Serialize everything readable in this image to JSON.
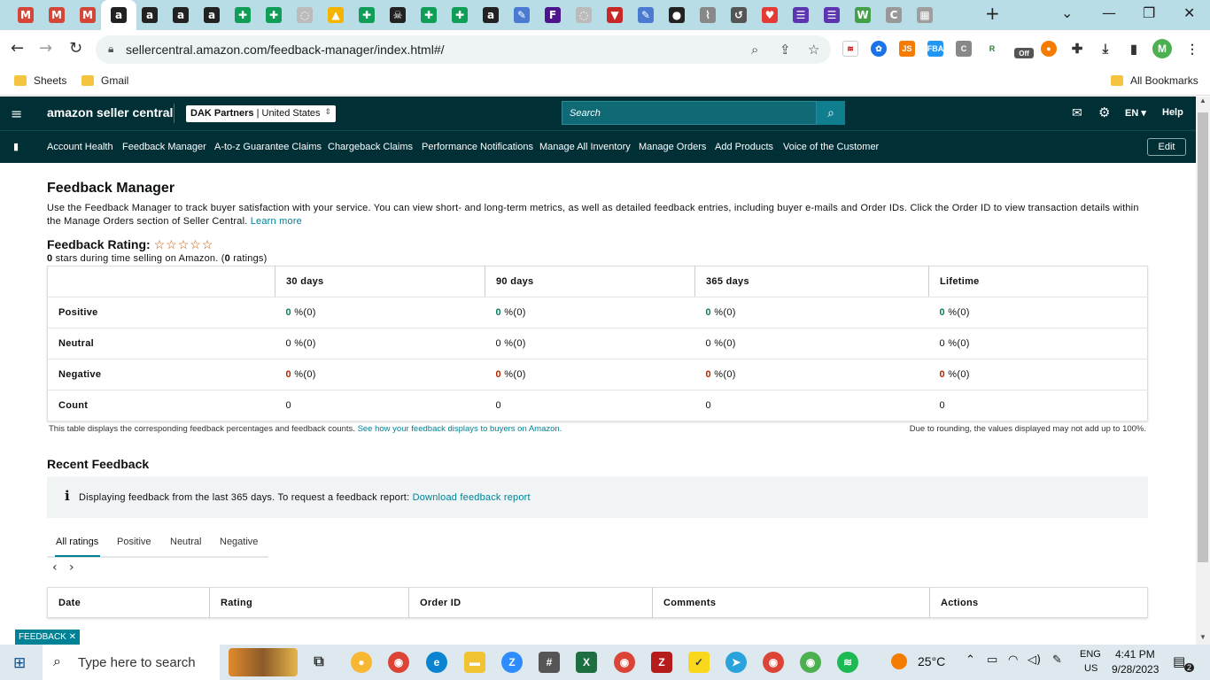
{
  "browser": {
    "url": "sellercentral.amazon.com/feedback-manager/index.html#/",
    "bookmarks": [
      "Sheets",
      "Gmail"
    ],
    "all_bookmarks": "All Bookmarks",
    "tab_icons": [
      "gmail-icon",
      "gmail-icon",
      "gmail-icon",
      "amazon-icon",
      "amazon-icon",
      "amazon-icon",
      "amazon-icon",
      "sheets-icon",
      "sheets-icon",
      "blank-icon",
      "drive-icon",
      "sheets-icon",
      "skull-icon",
      "sheets-icon",
      "sheets-icon",
      "amazon-icon",
      "pencil-icon",
      "fedex-icon",
      "blank-icon",
      "red-triangle-icon",
      "pencil-icon",
      "circle-icon",
      "chart-icon",
      "history-icon",
      "heart-icon",
      "list-icon",
      "list-icon",
      "w-icon",
      "c-icon",
      "ruler-icon"
    ],
    "extension_badge": "Off",
    "profile_initial": "M"
  },
  "header": {
    "logo": "amazon seller central",
    "account": "DAK Partners",
    "marketplace": "United States",
    "search_placeholder": "Search",
    "language": "EN",
    "help": "Help"
  },
  "nav": {
    "items": [
      "Account Health",
      "Feedback Manager",
      "A-to-z Guarantee Claims",
      "Chargeback Claims",
      "Performance Notifications",
      "Manage All Inventory",
      "Manage Orders",
      "Add Products",
      "Voice of the Customer"
    ],
    "edit": "Edit"
  },
  "page": {
    "title": "Feedback Manager",
    "description": "Use the Feedback Manager to track buyer satisfaction with your service. You can view short- and long-term metrics, as well as detailed feedback entries, including buyer e-mails and Order IDs. Click the Order ID to view transaction details within the Manage Orders section of Seller Central.",
    "learn_more": "Learn more",
    "rating_label": "Feedback Rating:",
    "rating_stars": "☆☆☆☆☆",
    "rating_value": "0",
    "rating_sub_mid": " stars during time selling on Amazon. (",
    "rating_count": "0",
    "rating_sub_end": " ratings)"
  },
  "metrics": {
    "columns": [
      "30 days",
      "90 days",
      "365 days",
      "Lifetime"
    ],
    "rows": [
      {
        "label": "Positive",
        "values": [
          [
            "0",
            " %(0)"
          ],
          [
            "0",
            " %(0)"
          ],
          [
            "0",
            " %(0)"
          ],
          [
            "0",
            " %(0)"
          ]
        ]
      },
      {
        "label": "Neutral",
        "values": [
          [
            "0",
            " %(0)"
          ],
          [
            "0",
            " %(0)"
          ],
          [
            "0",
            " %(0)"
          ],
          [
            "0",
            " %(0)"
          ]
        ]
      },
      {
        "label": "Negative",
        "values": [
          [
            "0",
            " %(0)"
          ],
          [
            "0",
            " %(0)"
          ],
          [
            "0",
            " %(0)"
          ],
          [
            "0",
            " %(0)"
          ]
        ]
      },
      {
        "label": "Count",
        "values": [
          [
            "0",
            ""
          ],
          [
            "0",
            ""
          ],
          [
            "0",
            ""
          ],
          [
            "0",
            ""
          ]
        ]
      }
    ],
    "note_left": "This table displays the corresponding feedback percentages and feedback counts.",
    "note_link": "See how your feedback displays to buyers on Amazon.",
    "note_right": "Due to rounding, the values displayed may not add up to 100%."
  },
  "recent": {
    "title": "Recent Feedback",
    "info_text": "Displaying feedback from the last 365 days. To request a feedback report:",
    "info_link": "Download feedback report",
    "tabs": [
      "All ratings",
      "Positive",
      "Neutral",
      "Negative"
    ],
    "columns": [
      "Date",
      "Rating",
      "Order ID",
      "Comments",
      "Actions"
    ]
  },
  "feedback_button": "FEEDBACK",
  "taskbar": {
    "search_placeholder": "Type here to search",
    "temperature": "25°C",
    "lang_top": "ENG",
    "lang_bottom": "US",
    "time": "4:41 PM",
    "date": "9/28/2023",
    "notif_count": "2"
  }
}
